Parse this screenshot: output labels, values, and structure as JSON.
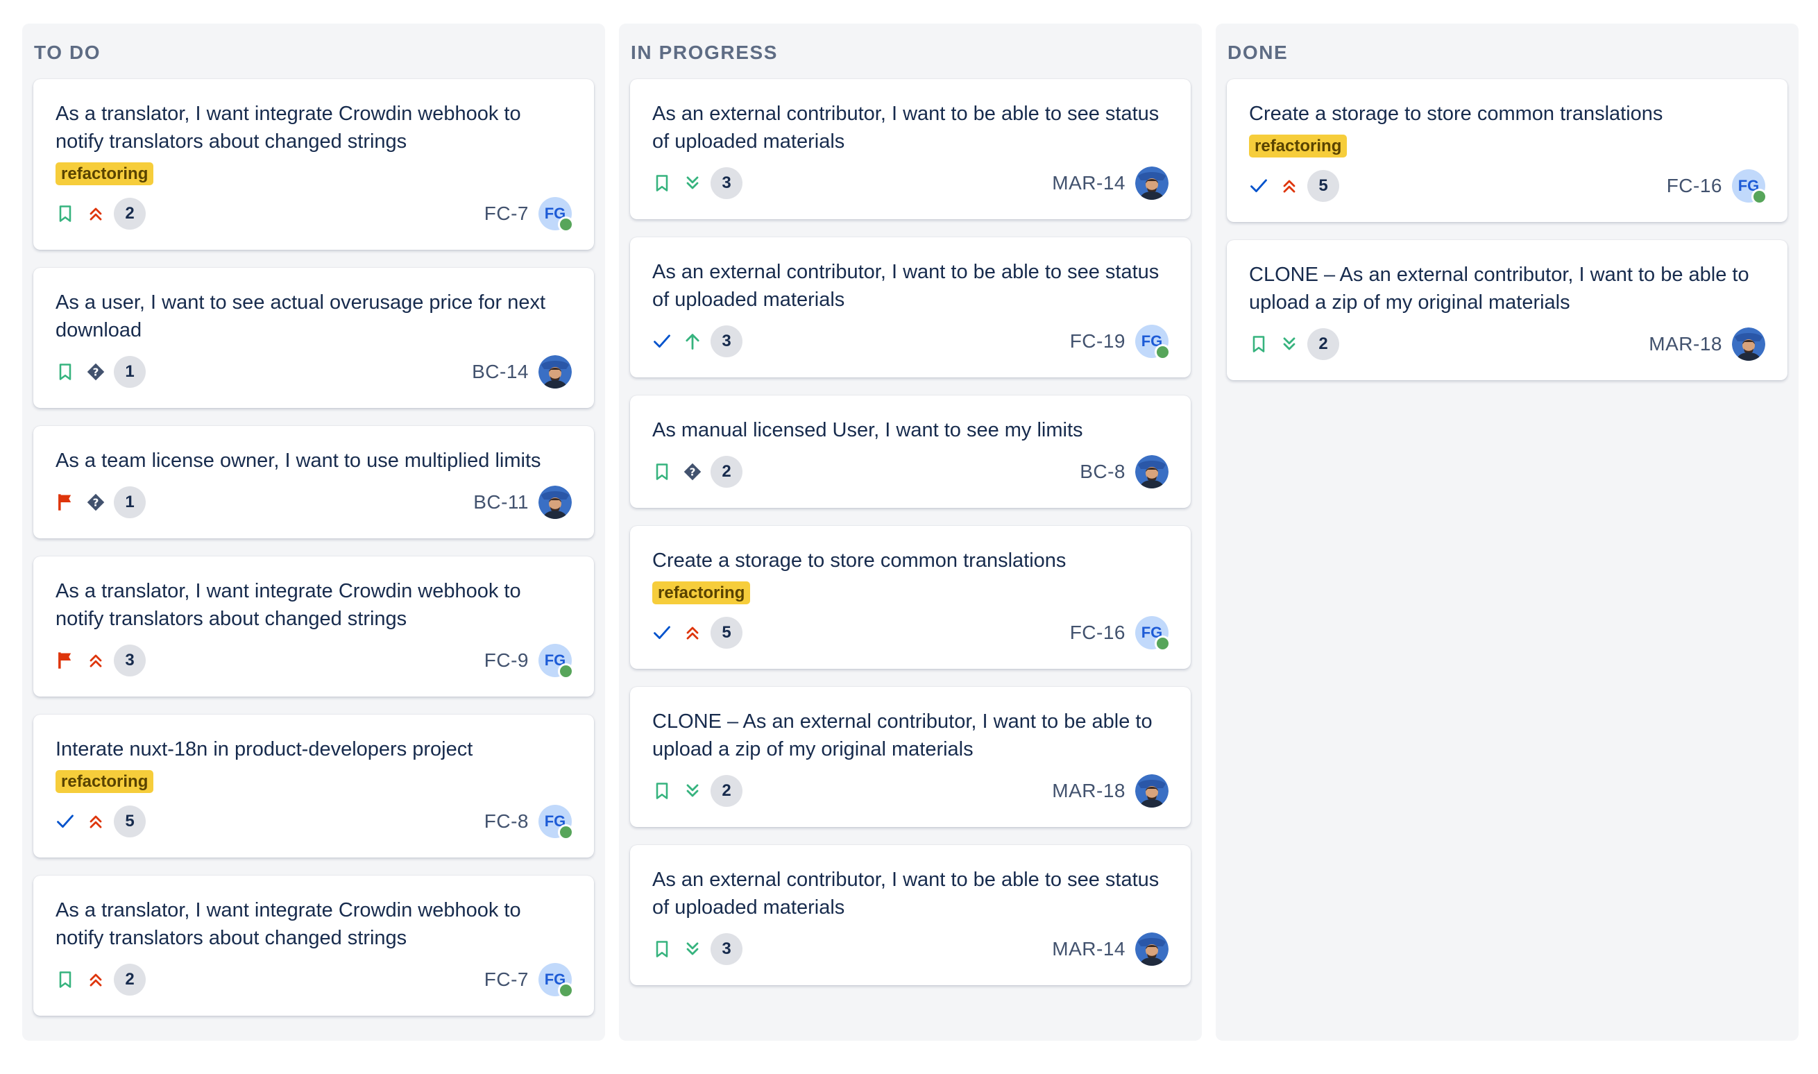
{
  "colors": {
    "flag_red": "#de350b",
    "bookmark_green": "#36b37e",
    "check_blue": "#0052cc",
    "priority_red": "#de350b",
    "priority_green": "#36b37e",
    "label_bg": "#f6cd3b"
  },
  "columns": [
    {
      "title": "TO DO",
      "cards": [
        {
          "title": "As a translator, I want integrate Crowdin webhook to notify translators about changed strings",
          "label": "refactoring",
          "type": "story",
          "priority": "highest",
          "count": "2",
          "key": "FC-7",
          "avatar": "FG"
        },
        {
          "title": "As a user, I want to see actual overusage price for next download",
          "label": "",
          "type": "story",
          "priority": "unknown",
          "count": "1",
          "key": "BC-14",
          "avatar": "photo"
        },
        {
          "title": "As a team license owner, I want to use multiplied limits",
          "label": "",
          "type": "flag",
          "priority": "unknown",
          "count": "1",
          "key": "BC-11",
          "avatar": "photo"
        },
        {
          "title": "As a translator, I want integrate Crowdin webhook to notify translators about changed strings",
          "label": "",
          "type": "flag",
          "priority": "highest",
          "count": "3",
          "key": "FC-9",
          "avatar": "FG"
        },
        {
          "title": "Interate nuxt-18n in product-developers project",
          "label": "refactoring",
          "type": "check",
          "priority": "highest",
          "count": "5",
          "key": "FC-8",
          "avatar": "FG"
        },
        {
          "title": "As a translator, I want integrate Crowdin webhook to notify translators about changed strings",
          "label": "",
          "type": "story",
          "priority": "highest",
          "count": "2",
          "key": "FC-7",
          "avatar": "FG"
        }
      ]
    },
    {
      "title": "IN PROGRESS",
      "cards": [
        {
          "title": "As an external contributor, I want to be able to see status of uploaded materials",
          "label": "",
          "type": "story",
          "priority": "lowest",
          "count": "3",
          "key": "MAR-14",
          "avatar": "photo"
        },
        {
          "title": "As an external contributor, I want to be able to see status of uploaded materials",
          "label": "",
          "type": "check",
          "priority": "high",
          "count": "3",
          "key": "FC-19",
          "avatar": "FG"
        },
        {
          "title": "As manual licensed User, I want to see my limits",
          "label": "",
          "type": "story",
          "priority": "unknown",
          "count": "2",
          "key": "BC-8",
          "avatar": "photo"
        },
        {
          "title": "Create a storage to store common translations",
          "label": "refactoring",
          "type": "check",
          "priority": "highest",
          "count": "5",
          "key": "FC-16",
          "avatar": "FG"
        },
        {
          "title": "CLONE – As an external contributor, I want to be able to upload a zip of my original materials",
          "label": "",
          "type": "story",
          "priority": "lowest",
          "count": "2",
          "key": "MAR-18",
          "avatar": "photo"
        },
        {
          "title": "As an external contributor, I want to be able to see status of uploaded materials",
          "label": "",
          "type": "story",
          "priority": "lowest",
          "count": "3",
          "key": "MAR-14",
          "avatar": "photo"
        }
      ]
    },
    {
      "title": "DONE",
      "cards": [
        {
          "title": "Create a storage to store common translations",
          "label": "refactoring",
          "type": "check",
          "priority": "highest",
          "count": "5",
          "key": "FC-16",
          "avatar": "FG"
        },
        {
          "title": "CLONE – As an external contributor, I want to be able to upload a zip of my original materials",
          "label": "",
          "type": "story",
          "priority": "lowest",
          "count": "2",
          "key": "MAR-18",
          "avatar": "photo"
        }
      ]
    }
  ]
}
